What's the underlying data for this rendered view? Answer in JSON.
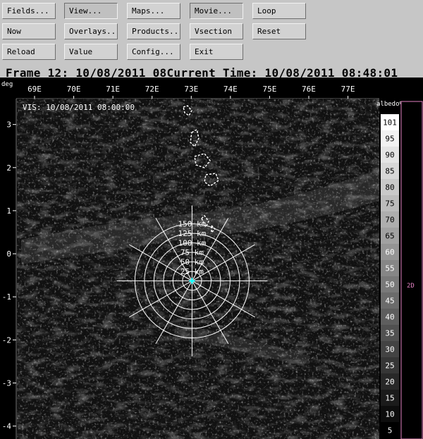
{
  "toolbar": {
    "rows": [
      [
        "Fields...",
        "View...",
        "Maps...",
        "Movie...",
        "Loop"
      ],
      [
        "Now",
        "Overlays...",
        "Products...",
        "Vsection",
        "Reset"
      ],
      [
        "Reload",
        "Value",
        "Config...",
        "Exit",
        ""
      ]
    ],
    "pressed": [
      "View...",
      "Movie..."
    ]
  },
  "status": {
    "frame": "Frame 12: 10/08/2011 08",
    "current": "Current Time: 10/08/2011 08:48:01"
  },
  "map": {
    "unit_label": "deg",
    "field_label": "VIS: 10/08/2011 08:00:00",
    "lon_ticks": [
      "69E",
      "70E",
      "71E",
      "72E",
      "73E",
      "74E",
      "75E",
      "76E",
      "77E"
    ],
    "lat_ticks": [
      "3",
      "2",
      "1",
      "0",
      "-1",
      "-2",
      "-3",
      "-4"
    ],
    "lon_range": [
      68.55,
      77.8
    ],
    "lat_range": [
      3.6,
      -4.3
    ],
    "range_rings": {
      "center": [
        73.02,
        -0.63
      ],
      "labels_km": [
        "25 km",
        "50 km",
        "75 km",
        "100 km",
        "125 km",
        "150 km"
      ]
    }
  },
  "colorbar": {
    "unit": "albedo%",
    "labels": [
      "101",
      "95",
      "90",
      "85",
      "80",
      "75",
      "70",
      "65",
      "60",
      "55",
      "50",
      "45",
      "40",
      "35",
      "30",
      "25",
      "20",
      "15",
      "10",
      "5"
    ],
    "height_label": "2D"
  },
  "colors": {
    "ring_color": "#ffffff",
    "range_label_color": "#ffffff",
    "marker_color": "#00ffff",
    "coast_color": "#ffffff",
    "side_panel_border": "#e080c0"
  }
}
